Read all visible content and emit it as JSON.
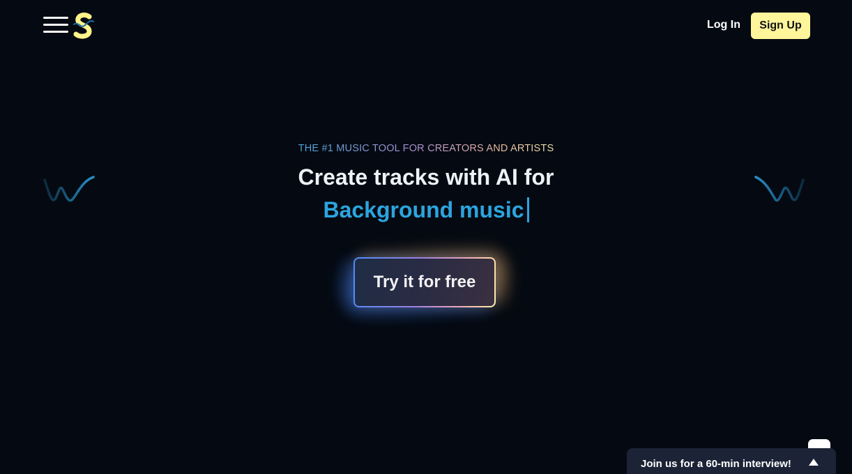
{
  "header": {
    "menu_icon": "hamburger-menu-icon",
    "logo_icon": "brand-s-logo",
    "login_label": "Log In",
    "signup_label": "Sign Up"
  },
  "hero": {
    "eyebrow": "THE #1 MUSIC TOOL FOR CREATORS AND ARTISTS",
    "headline": "Create tracks with AI for",
    "rotating_text": "Background music",
    "cta_label": "Try it for free"
  },
  "decorations": {
    "left_wave_icon": "sound-wave-icon",
    "right_wave_icon": "sound-wave-icon"
  },
  "widgets": {
    "chat_toggle_icon": "chat-toggle",
    "interview_banner_text": "Join us for a 60-min interview!",
    "interview_arrow_icon": "chevron-up-icon"
  },
  "colors": {
    "background": "#050a12",
    "accent_blue": "#2ca5df",
    "signup_yellow": "#fff59b",
    "banner_bg": "#1c2336"
  }
}
